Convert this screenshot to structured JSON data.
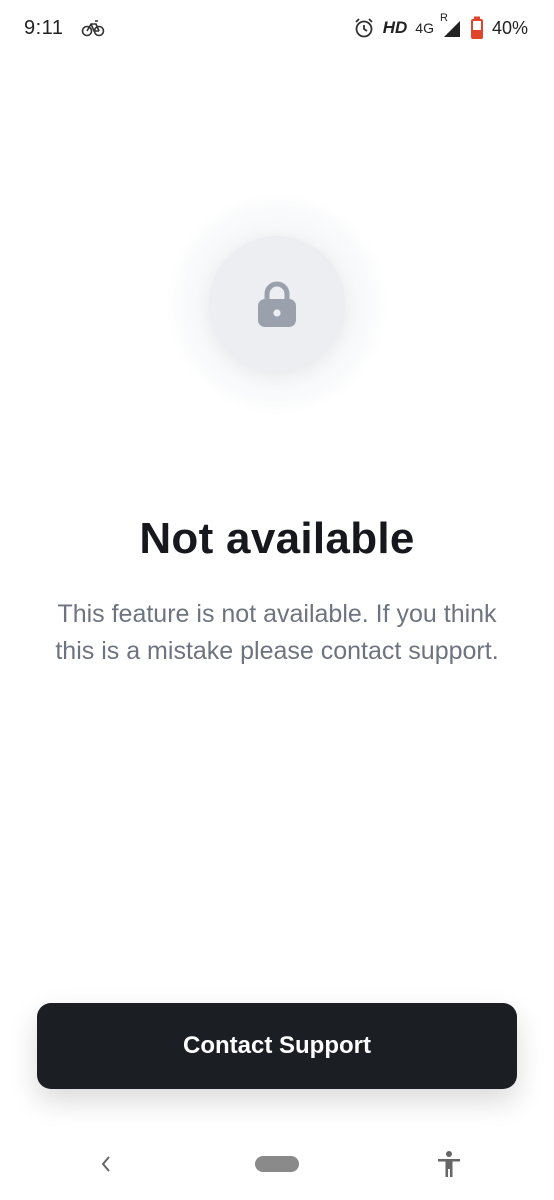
{
  "status_bar": {
    "time": "9:11",
    "hd_label": "HD",
    "network_label": "4G",
    "roaming_label": "R",
    "battery_percent": "40%"
  },
  "main": {
    "title": "Not available",
    "message": "This feature is not available. If you think this is a mistake please contact support.",
    "icon": "lock-icon"
  },
  "actions": {
    "contact_label": "Contact Support"
  },
  "nav_bar": {
    "back_icon": "chevron-left-icon",
    "home_icon": "home-pill",
    "accessibility_icon": "accessibility-icon"
  },
  "colors": {
    "button_bg": "#1b1e23",
    "title": "#16181d",
    "message": "#6d7480",
    "lock_icon": "#9aa1ad",
    "battery_fill": "#e0452b"
  }
}
